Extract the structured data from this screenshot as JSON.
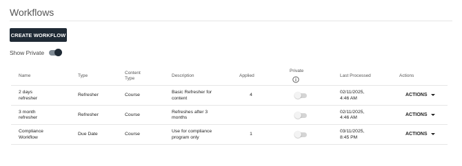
{
  "page": {
    "title": "Workflows"
  },
  "toolbar": {
    "create_label": "CREATE WORKFLOW"
  },
  "filter": {
    "show_private_label": "Show Private",
    "show_private_on": true
  },
  "table": {
    "headers": {
      "name": "Name",
      "type": "Type",
      "content_type_line1": "Content",
      "content_type_line2": "Type",
      "description": "Description",
      "applied": "Applied",
      "private": "Private",
      "last_processed": "Last Processed",
      "actions": "Actions"
    },
    "rows": [
      {
        "name_line1": "2 days",
        "name_line2": "refresher",
        "type": "Refresher",
        "content_type": "Course",
        "desc_line1": "Basic Refresher for",
        "desc_line2": "content",
        "applied": "4",
        "private": false,
        "last_line1": "02/11/2025,",
        "last_line2": "4:46 AM",
        "actions_label": "ACTIONS"
      },
      {
        "name_line1": "3 month",
        "name_line2": "refresher",
        "type": "Refresher",
        "content_type": "Course",
        "desc_line1": "Refreshes after 3",
        "desc_line2": "months",
        "applied": "",
        "private": false,
        "last_line1": "02/11/2025,",
        "last_line2": "4:46 AM",
        "actions_label": "ACTIONS"
      },
      {
        "name_line1": "Compliance",
        "name_line2": "Workflow",
        "type": "Due Date",
        "content_type": "Course",
        "desc_line1": "Use for compliance",
        "desc_line2": "program only",
        "applied": "1",
        "private": false,
        "last_line1": "03/11/2025,",
        "last_line2": "8:45 PM",
        "actions_label": "ACTIONS"
      }
    ]
  },
  "icons": {
    "info": "info-circle-icon",
    "caret": "caret-down-icon"
  }
}
